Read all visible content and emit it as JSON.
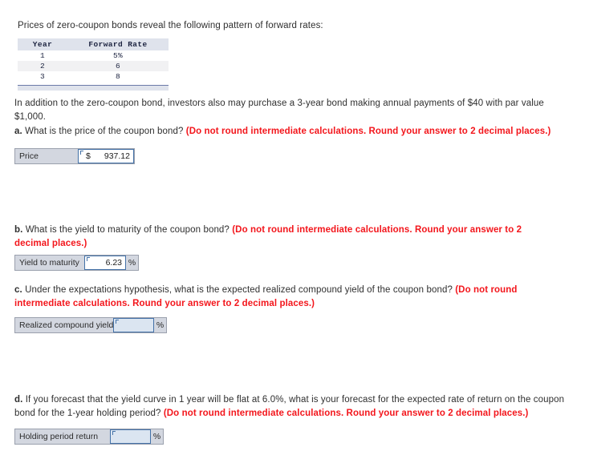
{
  "intro": {
    "text": "Prices of zero-coupon bonds reveal the following pattern of forward rates:"
  },
  "forward_table": {
    "headers": [
      "Year",
      "Forward Rate"
    ],
    "rows": [
      {
        "year": "1",
        "rate": "5%"
      },
      {
        "year": "2",
        "rate": "6"
      },
      {
        "year": "3",
        "rate": "8"
      }
    ]
  },
  "addendum": {
    "line1": "In addition to the zero-coupon bond, investors also may purchase a 3-year bond making annual payments of $40 with par value",
    "line2": "$1,000."
  },
  "questions": {
    "a": {
      "marker": "a.",
      "prompt": " What is the price of the coupon bond? ",
      "instruction": "(Do not round intermediate calculations. Round your answer to 2 decimal places.)",
      "field": {
        "label": "Price",
        "currency": "$",
        "value": "937.12",
        "suffix": ""
      }
    },
    "b": {
      "marker": "b.",
      "prompt": " What is the yield to maturity of the coupon bond? ",
      "instruction": "(Do not round intermediate calculations. Round your answer to 2 decimal places.)",
      "field": {
        "label": "Yield to maturity",
        "currency": "",
        "value": "6.23",
        "suffix": "%"
      }
    },
    "c": {
      "marker": "c.",
      "prompt": " Under the expectations hypothesis, what is the expected realized compound yield of the coupon bond? ",
      "instruction": "(Do not round intermediate calculations. Round your answer to 2 decimal places.)",
      "field": {
        "label": "Realized compound yield",
        "currency": "",
        "value": "",
        "suffix": "%"
      }
    },
    "d": {
      "marker": "d.",
      "prompt": " If you forecast that the yield curve in 1 year will be flat at 6.0%, what is your forecast for the expected rate of return on the coupon bond for the 1-year holding period? ",
      "instruction": "(Do not round intermediate calculations. Round your answer to 2 decimal places.)",
      "field": {
        "label": "Holding period return",
        "currency": "",
        "value": "",
        "suffix": "%"
      }
    }
  },
  "colors": {
    "instruction_red": "#f3161c",
    "body_text": "#2f2f2f",
    "field_label_bg": "#d3d7e0",
    "input_border": "#4472a8",
    "input_bg_empty": "#dbe5f1",
    "table_header_bg": "#dfe3ec"
  }
}
